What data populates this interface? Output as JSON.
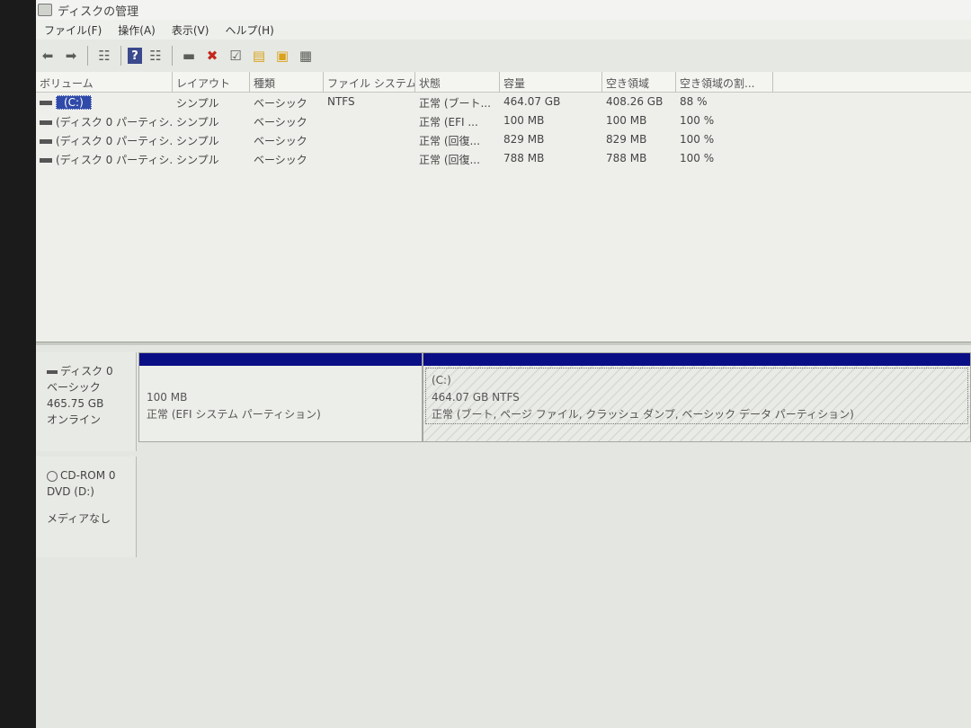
{
  "window": {
    "title": "ディスクの管理"
  },
  "menu": [
    "ファイル(F)",
    "操作(A)",
    "表示(V)",
    "ヘルプ(H)"
  ],
  "toolbar": {
    "buttons": [
      "back-arrow-icon",
      "forward-arrow-icon",
      "list-view-icon",
      "help-icon",
      "properties-icon",
      "connect-icon",
      "delete-icon",
      "check-icon",
      "folder-up-icon",
      "folder-search-icon",
      "settings-icon"
    ]
  },
  "volume_list": {
    "columns": [
      "ボリューム",
      "レイアウト",
      "種類",
      "ファイル システム",
      "状態",
      "容量",
      "空き領域",
      "空き領域の割..."
    ],
    "rows": [
      [
        "(C:)",
        "シンプル",
        "ベーシック",
        "NTFS",
        "正常 (ブート...",
        "464.07 GB",
        "408.26 GB",
        "88 %"
      ],
      [
        "(ディスク 0 パーティシ...",
        "シンプル",
        "ベーシック",
        "",
        "正常 (EFI ...",
        "100 MB",
        "100 MB",
        "100 %"
      ],
      [
        "(ディスク 0 パーティシ...",
        "シンプル",
        "ベーシック",
        "",
        "正常 (回復...",
        "829 MB",
        "829 MB",
        "100 %"
      ],
      [
        "(ディスク 0 パーティシ...",
        "シンプル",
        "ベーシック",
        "",
        "正常 (回復...",
        "788 MB",
        "788 MB",
        "100 %"
      ]
    ]
  },
  "disks": {
    "disk0": {
      "name": "ディスク 0",
      "type": "ベーシック",
      "size": "465.75 GB",
      "status": "オンライン",
      "partitions": [
        {
          "size": "100 MB",
          "status": "正常 (EFI システム パーティション)"
        },
        {
          "label": "(C:)",
          "size": "464.07 GB NTFS",
          "status": "正常 (ブート, ページ ファイル, クラッシュ ダンプ, ベーシック データ パーティション)"
        }
      ]
    },
    "cdrom0": {
      "name": "CD-ROM 0",
      "drive": "DVD (D:)",
      "status": "メディアなし"
    }
  },
  "colors": {
    "partition_band": "#0b0f86",
    "selected_volume": "#2f4aa8"
  }
}
